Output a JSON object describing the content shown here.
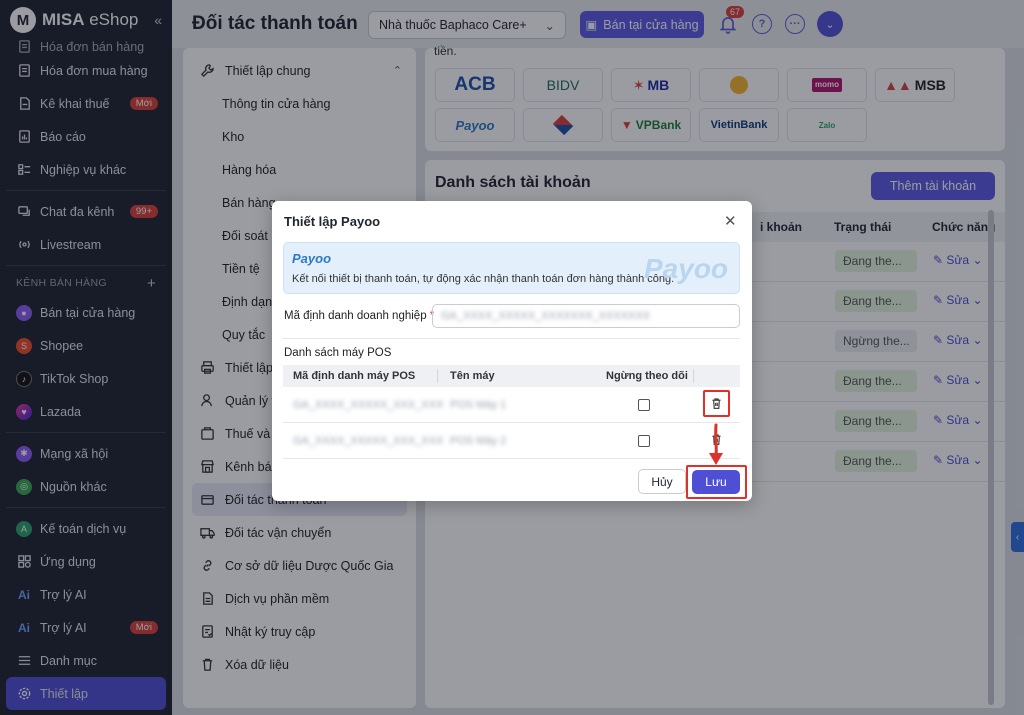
{
  "app": {
    "logo_letter": "M",
    "logo_bold": "MISA",
    "logo_thin": " eShop"
  },
  "header": {
    "title": "Đối tác thanh toán",
    "store": "Nhà thuốc Baphaco Care+",
    "sell_button": "Bán tại cửa hàng",
    "notification_count": "67"
  },
  "sidebar": {
    "items_top": [
      {
        "label": "Hóa đơn bán hàng",
        "icon": "receipt-icon"
      },
      {
        "label": "Hóa đơn mua hàng",
        "icon": "receipt-icon"
      },
      {
        "label": "Kê khai thuế",
        "icon": "tax-doc-icon",
        "badge": "Mới"
      },
      {
        "label": "Báo cáo",
        "icon": "report-icon"
      },
      {
        "label": "Nghiệp vụ khác",
        "icon": "list-icon"
      }
    ],
    "items_mid": [
      {
        "label": "Chat đa kênh",
        "icon": "chat-icon",
        "badge": "99+"
      },
      {
        "label": "Livestream",
        "icon": "livestream-icon"
      }
    ],
    "section_label": "KÊNH BÁN HÀNG",
    "channels": [
      {
        "label": "Bán tại cửa hàng",
        "color": "#8a5cf6"
      },
      {
        "label": "Shopee",
        "color": "#ee4d2d"
      },
      {
        "label": "TikTok Shop",
        "color": "#111111"
      },
      {
        "label": "Lazada",
        "color": "#3b2bd9"
      }
    ],
    "items_social": [
      {
        "label": "Mạng xã hội",
        "color": "#8a5cf6"
      },
      {
        "label": "Nguồn khác",
        "color": "#3aa655"
      }
    ],
    "items_bottom": [
      {
        "label": "Kế toán dịch vụ",
        "icon": "accounting-icon"
      },
      {
        "label": "Ứng dụng",
        "icon": "apps-icon"
      },
      {
        "label": "Trợ lý AI",
        "icon": "ai-icon"
      },
      {
        "label": "Trợ lý AI",
        "icon": "ai-icon",
        "badge": "Mới"
      },
      {
        "label": "Danh mục",
        "icon": "menu-icon"
      },
      {
        "label": "Thiết lập",
        "icon": "settings-icon"
      }
    ]
  },
  "settings_menu": {
    "group": "Thiết lập chung",
    "sub_items": [
      "Thông tin cửa hàng",
      "Kho",
      "Hàng hóa",
      "Bán hàng",
      "Đối soát",
      "Tiền tệ",
      "Định dạng",
      "Quy tắc"
    ],
    "items": [
      {
        "label": "Thiết lập",
        "icon": "printer-icon"
      },
      {
        "label": "Quản lý v",
        "icon": "user-icon"
      },
      {
        "label": "Thuế và",
        "icon": "tax-icon"
      },
      {
        "label": "Kênh bán",
        "icon": "store-icon"
      },
      {
        "label": "Đối tác thanh toán",
        "icon": "card-icon"
      },
      {
        "label": "Đối tác vận chuyển",
        "icon": "truck-icon"
      },
      {
        "label": "Cơ sở dữ liệu Dược Quốc Gia",
        "icon": "link-icon"
      },
      {
        "label": "Dịch vụ phần mềm",
        "icon": "doc-icon"
      },
      {
        "label": "Nhật ký truy cập",
        "icon": "log-icon"
      },
      {
        "label": "Xóa dữ liệu",
        "icon": "trash-icon"
      }
    ]
  },
  "content": {
    "intro_tail": "tiền.",
    "banks": [
      "ACB",
      "BIDV",
      "MB",
      "",
      "momo",
      "MSB",
      "Payoo",
      "",
      "VPBank",
      "VietinBank",
      "Zalo"
    ],
    "accounts_title": "Danh sách tài khoản",
    "add_account": "Thêm tài khoản",
    "columns": {
      "account": "i khoản",
      "status": "Trạng thái",
      "actions": "Chức năng"
    },
    "rows": [
      {
        "status": "Đang the...",
        "edit": "Sửa"
      },
      {
        "status": "Đang the...",
        "edit": "Sửa"
      },
      {
        "status": "Ngừng the...",
        "edit": "Sửa"
      },
      {
        "status": "Đang the...",
        "edit": "Sửa"
      },
      {
        "status": "Đang the...",
        "edit": "Sửa"
      },
      {
        "status": "Đang the...",
        "edit": "Sửa"
      }
    ]
  },
  "modal": {
    "title": "Thiết lập Payoo",
    "brand": "Payoo",
    "description": "Kết nối thiết bị thanh toán, tự động xác nhận thanh toán đơn hàng thành công.",
    "merchant_label": "Mã định danh doanh nghiệp",
    "merchant_value": "GA_XXXX_XXXXX_XXXXXXX_XXXXXXX",
    "pos_title": "Danh sách máy POS",
    "pos_columns": {
      "code": "Mã định danh máy POS",
      "name": "Tên máy",
      "stop": "Ngừng theo dõi"
    },
    "pos_rows": [
      {
        "code": "GA_XXXX_XXXXX_XXX_XXX",
        "name": "POS Máy 1"
      },
      {
        "code": "GA_XXXX_XXXXX_XXX_XXX",
        "name": "POS Máy 2"
      }
    ],
    "cancel": "Hủy",
    "save": "Lưu"
  }
}
